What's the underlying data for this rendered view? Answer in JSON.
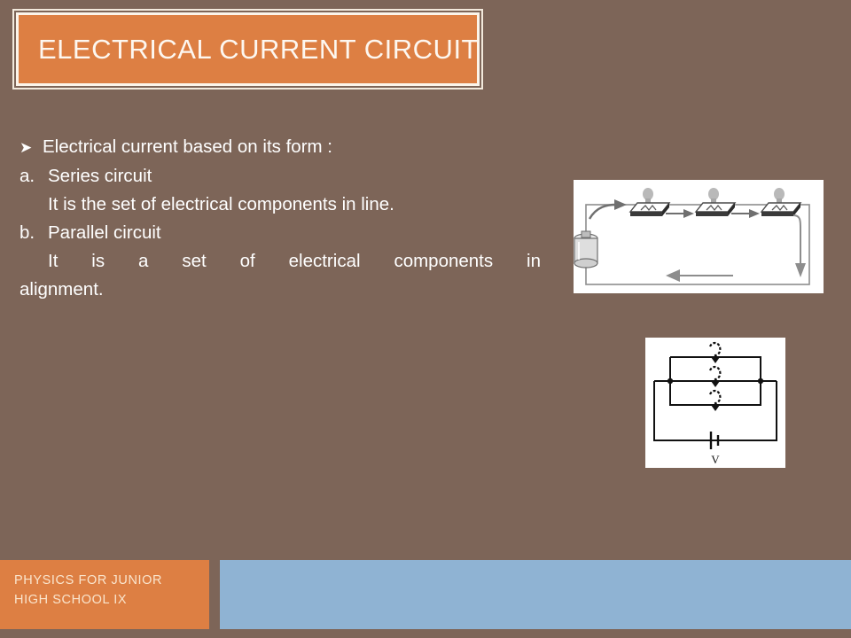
{
  "slide": {
    "title": "ELECTRICAL CURRENT CIRCUIT",
    "background_color": "#7d6558",
    "accent_color": "#dd7f43",
    "secondary_color": "#8fb3d3",
    "text_color": "#ffffff"
  },
  "content": {
    "bullet_glyph": "➤",
    "intro": "Electrical current based on its form :",
    "items": [
      {
        "marker": "a.",
        "heading": "Series circuit",
        "description": "It is the set of electrical components in line."
      },
      {
        "marker": "b.",
        "heading": "Parallel circuit",
        "description_part1": "It is a set of electrical components in",
        "description_part2": "alignment."
      }
    ]
  },
  "figures": {
    "series": {
      "caption": "",
      "battery_label": "",
      "lamp_count": 3,
      "alt": "series-circuit-diagram"
    },
    "parallel": {
      "caption": "V",
      "lamp_count": 3,
      "alt": "parallel-circuit-diagram"
    }
  },
  "footer": {
    "line1": "PHYSICS FOR JUNIOR",
    "line2": "HIGH SCHOOL IX"
  }
}
